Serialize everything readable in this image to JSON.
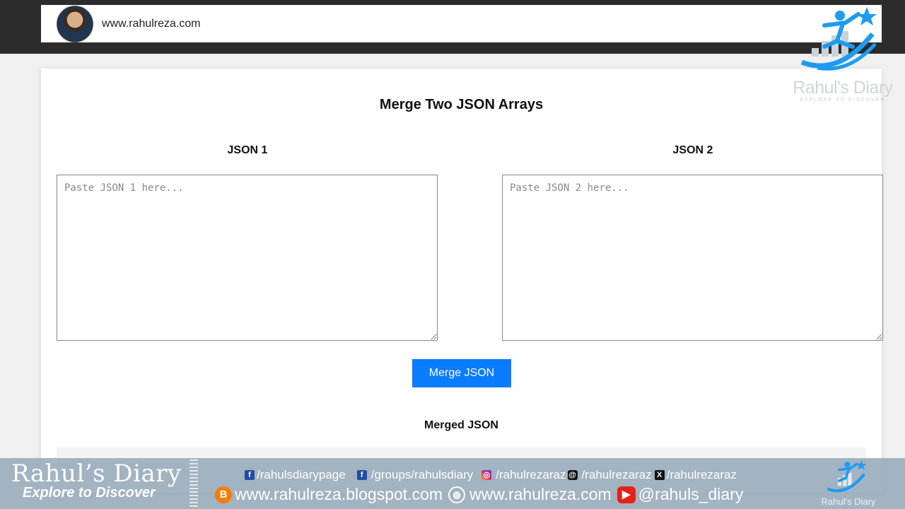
{
  "browser": {
    "url": "www.rahulreza.com"
  },
  "page": {
    "title": "Merge Two JSON Arrays",
    "json1": {
      "heading": "JSON 1",
      "placeholder": "Paste JSON 1 here...",
      "value": ""
    },
    "json2": {
      "heading": "JSON 2",
      "placeholder": "Paste JSON 2 here...",
      "value": ""
    },
    "merge_button": "Merge JSON",
    "output_heading": "Merged JSON",
    "output_value": ""
  },
  "watermark": {
    "name": "Rahul's Diary",
    "tagline": "EXPLORE TO DISCOVER"
  },
  "footer": {
    "brand": "Rahul’s Diary",
    "tagline": "Explore to Discover",
    "social_row": [
      {
        "icon": "facebook-icon",
        "text": "/rahulsdiarypage"
      },
      {
        "icon": "facebook-icon",
        "text": "/groups/rahulsdiary"
      },
      {
        "icon": "instagram-icon",
        "text": "/rahulrezaraz"
      },
      {
        "icon": "threads-icon",
        "text": "/rahulrezaraz"
      },
      {
        "icon": "x-icon",
        "text": "/rahulrezaraz"
      }
    ],
    "links_row": [
      {
        "icon": "blogger-icon",
        "text": "www.rahulreza.blogspot.com"
      },
      {
        "icon": "globe-icon",
        "text": "www.rahulreza.com"
      },
      {
        "icon": "youtube-icon",
        "text": "@rahuls_diary"
      }
    ],
    "logo_text": "Rahul's Diary"
  },
  "colors": {
    "accent": "#0a7cff",
    "topbar": "#2c2c2c",
    "logo_blue": "#1e9bf0"
  }
}
